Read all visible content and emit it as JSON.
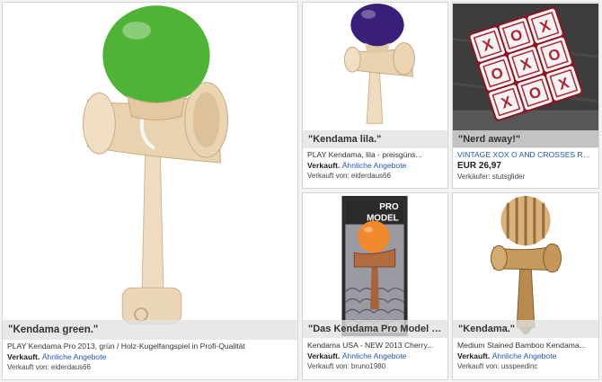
{
  "listings": [
    {
      "caption": "\"Kendama green.\"",
      "title": "PLAY Kendama Pro 2013, grün / Holz-Kugelfangspiel in Profi-Qualität",
      "status": "Verkauft.",
      "similar": "Ähnliche Angebote",
      "seller": "Verkauft von: eiderdaus66",
      "ball_color": "#4fb336"
    },
    {
      "caption": "\"Kendama lila.\"",
      "title": "PLAY Kendama, lila - preisgüns...",
      "status": "Verkauft.",
      "similar": "Ähnliche Angebote",
      "seller": "Verkauft von: eiderdaus66",
      "ball_color": "#3a1f7a"
    },
    {
      "caption": "\"Nerd away!\"",
      "title": "VINTAGE XOX O AND CROSSES RUBI...",
      "price": "EUR 26,97",
      "seller": "Verkäufer: stutsglider",
      "cube_color": "#b61f2e"
    },
    {
      "caption": "\"Das Kendama Pro Model von K...\"",
      "title": "Kendama USA - NEW 2013 Cherry...",
      "status": "Verkauft.",
      "similar": "Ähnliche Angebote",
      "seller": "Verkauft von: bruno1980",
      "package_text_1": "PRO",
      "package_text_2": "MODEL",
      "ball_color": "#f08a2c"
    },
    {
      "caption": "\"Kendama.\"",
      "title": "Medium Stained Bamboo Kendama...",
      "status": "Verkauft.",
      "similar": "Ähnliche Angebote",
      "seller": "Verkauft von: usspeedinc"
    }
  ],
  "cube_symbols": [
    "X",
    "O",
    "X",
    "O",
    "X",
    "O",
    "X",
    "O",
    "X"
  ],
  "colors": {
    "link": "#2456b7",
    "card_border": "#d6d6d6",
    "wood": "#e9d2b0"
  }
}
